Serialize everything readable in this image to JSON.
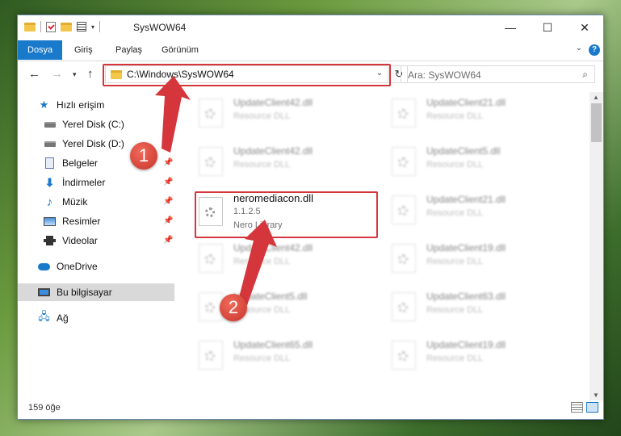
{
  "window": {
    "title": "SysWOW64",
    "controls": {
      "minimize": "—",
      "maximize": "☐",
      "close": "✕"
    }
  },
  "ribbon": {
    "tabs": [
      "Dosya",
      "Giriş",
      "Paylaş",
      "Görünüm"
    ],
    "help": "?"
  },
  "navigation": {
    "address_path": "C:\\Windows\\SysWOW64",
    "search_placeholder": "Ara: SysWOW64"
  },
  "sidebar": {
    "quick_access": "Hızlı erişim",
    "pinned": [
      {
        "label": "Yerel Disk (C:)",
        "icon": "disk-icon"
      },
      {
        "label": "Yerel Disk (D:)",
        "icon": "disk-icon"
      },
      {
        "label": "Belgeler",
        "icon": "documents-icon"
      },
      {
        "label": "İndirmeler",
        "icon": "downloads-icon"
      },
      {
        "label": "Müzik",
        "icon": "music-icon"
      },
      {
        "label": "Resimler",
        "icon": "pictures-icon"
      },
      {
        "label": "Videolar",
        "icon": "videos-icon"
      }
    ],
    "onedrive": "OneDrive",
    "this_pc": "Bu bilgisayar",
    "network": "Ağ"
  },
  "files": {
    "left_column": [
      {
        "name": "UpdateClient42.dll",
        "type": "Resource DLL"
      },
      {
        "name": "UpdateClient42.dll",
        "type": "Resource DLL"
      },
      {
        "name": "neromediacon.dll",
        "version": "1.1.2.5",
        "type": "Nero Library"
      },
      {
        "name": "UpdateClient42.dll",
        "type": "Resource DLL"
      },
      {
        "name": "UpdateClient5.dll",
        "type": "Resource DLL"
      },
      {
        "name": "UpdateClient65.dll",
        "type": "Resource DLL"
      }
    ],
    "right_column": [
      {
        "name": "UpdateClient21.dll",
        "type": "Resource DLL"
      },
      {
        "name": "UpdateClient5.dll",
        "type": "Resource DLL"
      },
      {
        "name": "UpdateClient21.dll",
        "type": "Resource DLL"
      },
      {
        "name": "UpdateClient19.dll",
        "type": "Resource DLL"
      },
      {
        "name": "UpdateClient63.dll",
        "type": "Resource DLL"
      },
      {
        "name": "UpdateClient19.dll",
        "type": "Resource DLL"
      }
    ]
  },
  "status": {
    "item_count": "159 öğe"
  },
  "annotations": {
    "step1": "1",
    "step2": "2",
    "highlight_color": "#d4363c"
  },
  "colors": {
    "accent": "#1979ca"
  }
}
